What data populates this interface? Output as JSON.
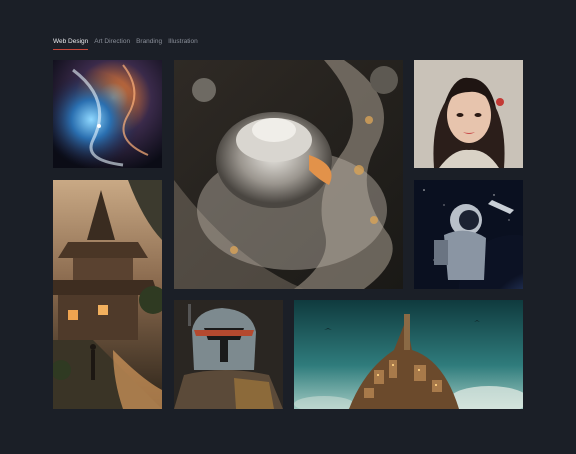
{
  "nav": {
    "tabs": [
      {
        "label": "Web Design",
        "active": true
      },
      {
        "label": "Art Direction",
        "active": false
      },
      {
        "label": "Branding",
        "active": false
      },
      {
        "label": "Illustration",
        "active": false
      }
    ]
  },
  "gallery": {
    "items": [
      {
        "name": "cosmic-vortex"
      },
      {
        "name": "futuristic-building-aerial"
      },
      {
        "name": "woman-portrait"
      },
      {
        "name": "pagoda-temple-path"
      },
      {
        "name": "astronaut-space"
      },
      {
        "name": "helmeted-warrior"
      },
      {
        "name": "floating-island-city"
      }
    ]
  },
  "colors": {
    "background": "#1b1f27",
    "active_tab_underline": "#c8483b",
    "tab_text": "#8a8f99",
    "tab_text_active": "#e8e9ec"
  }
}
